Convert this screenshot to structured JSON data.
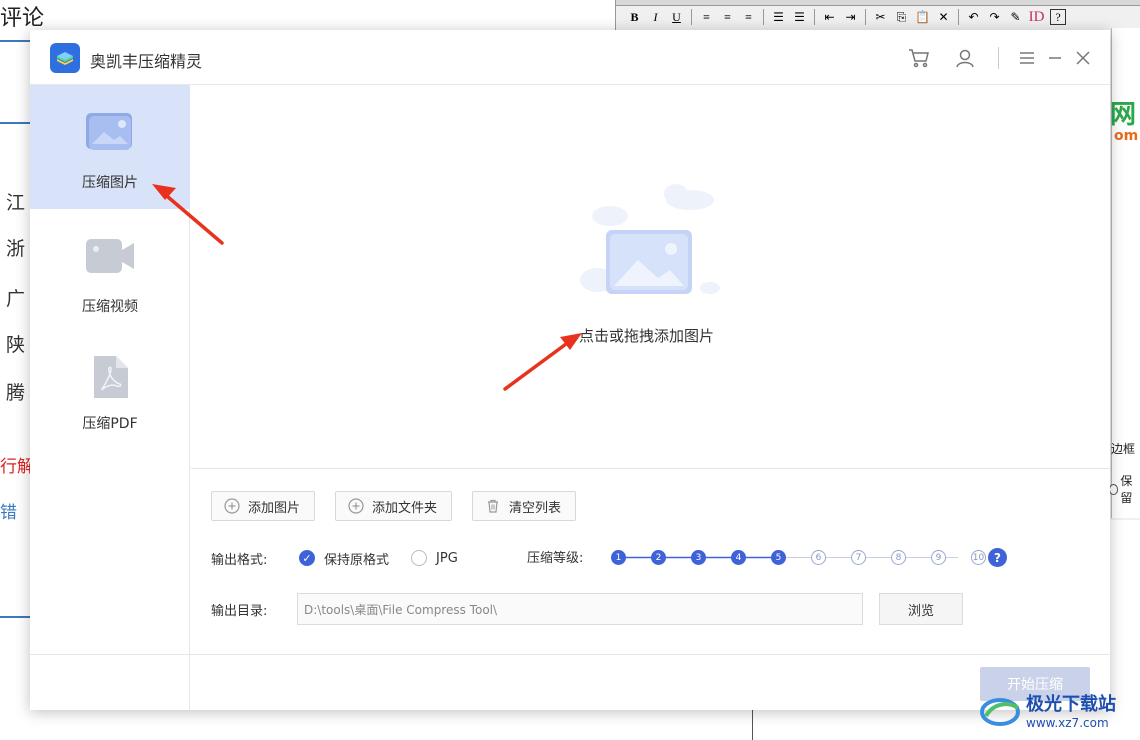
{
  "background": {
    "title_fragment": "评论",
    "list_fragments": [
      "江",
      "浙",
      "广",
      "陕",
      "腾"
    ],
    "red_fragment": "行解",
    "blue_fragment": "错",
    "editor_watermark": "网",
    "editor_watermark2": "om",
    "editor_label": "边框",
    "editor_radio": "保留",
    "toolbar": [
      "B",
      "I",
      "U",
      "≡",
      "≡",
      "≡",
      "☰",
      "☰",
      "⇤",
      "⇥",
      "✂",
      "⎘",
      "📋",
      "✕",
      "↶",
      "↷",
      "✎",
      "ID",
      "?"
    ]
  },
  "dialog": {
    "app_title": "奥凯丰压缩精灵",
    "titlebar_icons": [
      "cart-icon",
      "user-icon",
      "menu-icon",
      "minimize-icon",
      "close-icon"
    ]
  },
  "sidebar": {
    "items": [
      {
        "label": "压缩图片",
        "icon": "image-icon",
        "active": true
      },
      {
        "label": "压缩视频",
        "icon": "video-icon",
        "active": false
      },
      {
        "label": "压缩PDF",
        "icon": "pdf-icon",
        "active": false
      }
    ]
  },
  "drop_zone": {
    "prompt": "点击或拖拽添加图片"
  },
  "actions": {
    "add_image": "添加图片",
    "add_folder": "添加文件夹",
    "clear_list": "清空列表"
  },
  "format": {
    "label": "输出格式:",
    "options": [
      {
        "label": "保持原格式",
        "selected": true
      },
      {
        "label": "JPG",
        "selected": false
      }
    ]
  },
  "compression": {
    "label": "压缩等级:",
    "levels": [
      "1",
      "2",
      "3",
      "4",
      "5",
      "6",
      "7",
      "8",
      "9",
      "10"
    ],
    "selected_level": 5
  },
  "output": {
    "label": "输出目录:",
    "path": "D:\\tools\\桌面\\File Compress Tool\\",
    "browse": "浏览"
  },
  "start_button": "开始压缩",
  "site_watermark": {
    "name": "极光下载站",
    "url": "www.xz7.com"
  },
  "colors": {
    "accent": "#3e63d8",
    "sidebar_active": "#d8e2f8",
    "arrow": "#e8321e"
  }
}
